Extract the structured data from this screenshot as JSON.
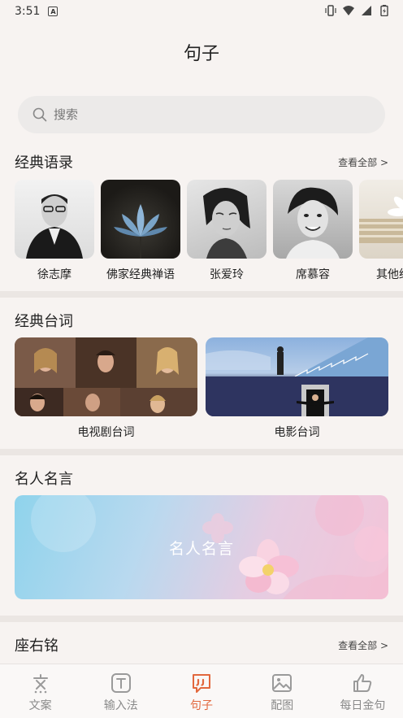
{
  "status": {
    "time": "3:51",
    "app_badge": "A"
  },
  "page_title": "句子",
  "search": {
    "placeholder": "搜索"
  },
  "sections": {
    "classic_quotes": {
      "title": "经典语录",
      "more": "查看全部 >",
      "items": [
        {
          "label": "徐志摩"
        },
        {
          "label": "佛家经典禅语"
        },
        {
          "label": "张爱玲"
        },
        {
          "label": "席慕容"
        },
        {
          "label": "其他经典"
        }
      ]
    },
    "classic_lines": {
      "title": "经典台词",
      "items": [
        {
          "label": "电视剧台词"
        },
        {
          "label": "电影台词"
        }
      ]
    },
    "famous_sayings": {
      "title": "名人名言",
      "banner_text": "名人名言"
    },
    "mottos": {
      "title": "座右铭",
      "more": "查看全部 >"
    }
  },
  "bottom_nav": [
    {
      "label": "文案",
      "icon": "text-icon",
      "active": false
    },
    {
      "label": "输入法",
      "icon": "keyboard-t-icon",
      "active": false
    },
    {
      "label": "句子",
      "icon": "quote-icon",
      "active": true
    },
    {
      "label": "配图",
      "icon": "image-icon",
      "active": false
    },
    {
      "label": "每日金句",
      "icon": "thumbs-up-icon",
      "active": false
    }
  ],
  "colors": {
    "accent": "#e2683d",
    "background": "#f7f3f1",
    "divider": "#ebe6e3"
  }
}
